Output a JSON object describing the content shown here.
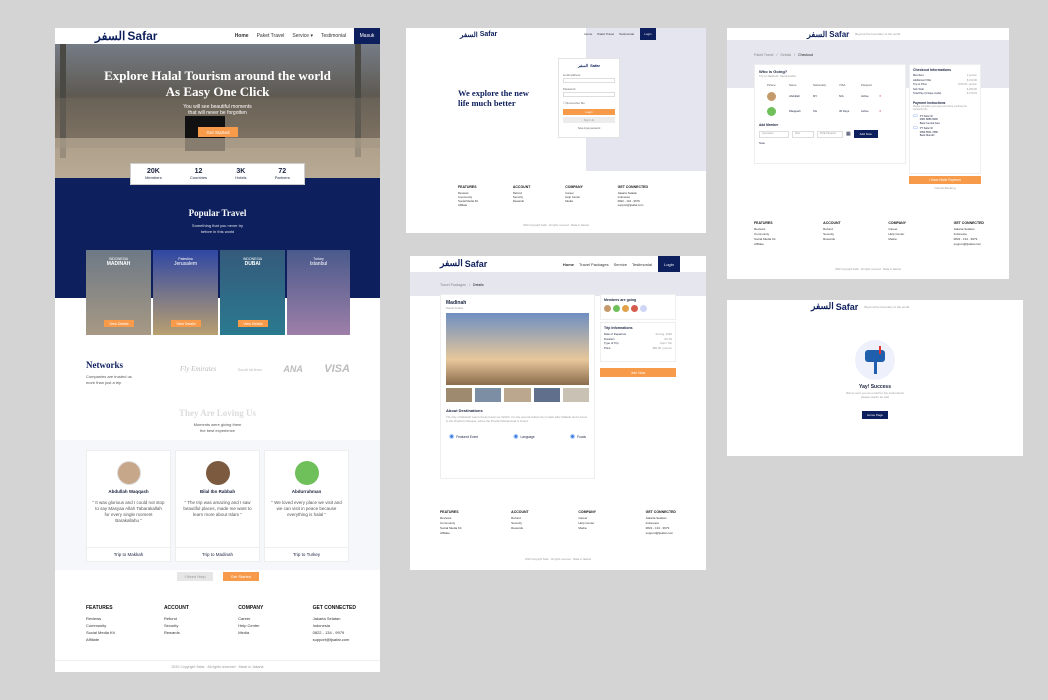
{
  "brand": {
    "arabic": "السفر",
    "latin": "Safar",
    "tagline": "Beyond the boundary of the world"
  },
  "nav": {
    "home": "Home",
    "packages": "Paket Travel",
    "service": "Service",
    "testimonial": "Testimonial",
    "login": "Masuk"
  },
  "nav2": {
    "home": "Home",
    "packages": "Travel Packages",
    "service": "Service",
    "testimonial": "Testimonial",
    "login": "Login"
  },
  "hero": {
    "title": "Explore Halal Tourism around the world\nAs Easy One Click",
    "subtitle": "You will see beautiful moments\nthat will never be forgotten",
    "cta": "Get Started"
  },
  "stats": [
    {
      "value": "20K",
      "label": "Members"
    },
    {
      "value": "12",
      "label": "Countries"
    },
    {
      "value": "3K",
      "label": "Hotels"
    },
    {
      "value": "72",
      "label": "Partners"
    }
  ],
  "popular": {
    "title": "Popular Travel",
    "subtitle": "Something that you never try\nbefore in this world",
    "cards": [
      {
        "country": "INDONESIA",
        "city": "MADINAH",
        "cta": "View Details"
      },
      {
        "country": "Palestina",
        "city": "Jerusalem",
        "cta": "View Details"
      },
      {
        "country": "INDONESIA",
        "city": "DUBAI",
        "cta": "View Details"
      },
      {
        "country": "Turkey",
        "city": "Istanbul",
        "cta": "View Details"
      }
    ]
  },
  "networks": {
    "title": "Networks",
    "subtitle": "Companies are trusted us\nmore than just a trip",
    "logos": [
      "Fly Emirates",
      "Saudi Airlines",
      "ANA",
      "VISA"
    ]
  },
  "testimonials": {
    "title": "They Are Loving Us",
    "subtitle": "Moments were giving them\nthe best experience",
    "items": [
      {
        "name": "Abdullah Waqqash",
        "quote": "\" It was glorious and I could not stop to say Masyaa Allah Tabarakallah for every single moment Barakallahu \"",
        "trip": "Trip to Makkah"
      },
      {
        "name": "Bilal Ibn Rabbah",
        "quote": "\" The trip was amazing and I saw beautiful places, made me want to learn more about Islam \"",
        "trip": "Trip to Madinah"
      },
      {
        "name": "Abdurrahman",
        "quote": "\" We loved every place we visit and we can visit in peace because everything is halal \"",
        "trip": "Trip to Turkey"
      }
    ],
    "help": "I Need Help",
    "cta": "Get Started"
  },
  "footer": {
    "cols": [
      {
        "title": "FEATURES",
        "items": [
          "Reviews",
          "Community",
          "Social Media Kit",
          "Affiliate"
        ]
      },
      {
        "title": "ACCOUNT",
        "items": [
          "Refund",
          "Security",
          "Rewards"
        ]
      },
      {
        "title": "COMPANY",
        "items": [
          "Career",
          "Help Center",
          "Media"
        ]
      },
      {
        "title": "GET CONNECTED",
        "items": [
          "Jakarta Selatan",
          "Indonesia",
          "0822 - 134 - 9979",
          "support@tjsafar.com"
        ]
      }
    ],
    "copyright": "2020 Copyright Safar · All rights reserved · Made in Jakarta"
  },
  "login": {
    "headline": "We explore the new\nlife much better",
    "email": "email address",
    "password": "Password",
    "remember": "Remember Me",
    "login": "Login",
    "signup": "Sign Up",
    "forgot": "Saya lupa password"
  },
  "detail": {
    "crumbs": [
      "Travel Packages",
      "Details"
    ],
    "title": "Madinah",
    "country": "Saudi Arabia",
    "about_title": "About Destinations",
    "about": "The City of Madinah was formerly known as Yathrib. It is the second holiest city in Islam after Makkah and is home to the Prophet's Mosque, where the Prophet Muhammad is buried.",
    "features": [
      "Featured Event",
      "Language",
      "Foods"
    ],
    "members_title": "Members are going",
    "trip_title": "Trip Informations",
    "trip_rows": [
      [
        "Date of Departure",
        "22 Aug, 2020"
      ],
      [
        "Duration",
        "4D 3N"
      ],
      [
        "Type of Trip",
        "Open Trip"
      ],
      [
        "Price",
        "$80,00 / person"
      ]
    ],
    "join": "Join Now"
  },
  "checkout": {
    "crumbs": [
      "Paket Travel",
      "Details",
      "Checkout"
    ],
    "who": "Who is Going?",
    "who_sub": "Trip to Madinah, Saudi Arabia",
    "headers": [
      "Picture",
      "Name",
      "Nationality",
      "VISA",
      "Passport"
    ],
    "rows": [
      [
        "Abdullah",
        "MY",
        "N/A",
        "Active"
      ],
      [
        "Waqqash",
        "SG",
        "30 Days",
        "Active"
      ]
    ],
    "add_member": "Add Member",
    "username": "Username",
    "visa": "Visa",
    "doe": "DOE Passport",
    "add_now": "Add Now",
    "note": "Note",
    "summary_title": "Checkout Informations",
    "summary": [
      [
        "Members",
        "2 person"
      ],
      [
        "Additional VISA",
        "$ 190,00"
      ],
      [
        "Trip to Price",
        "$ 80,00 / person"
      ],
      [
        "Sub Total",
        "$ 280,00"
      ],
      [
        "Total Pay (Unique Code)",
        "$ 279,33"
      ]
    ],
    "payment": "Payment Instructions",
    "payment_sub": "Please complete your payment before continue the wonderful trip",
    "banks": [
      [
        "PT Safar ID",
        "0881 8888 9999",
        "Bank Central Asia"
      ],
      [
        "PT Safar ID",
        "0899 8501 7888",
        "Bank Mandiri"
      ]
    ],
    "pay_btn": "I Have Made Payment",
    "cancel": "Cancel Booking",
    "footer_extra": [
      "Reviews",
      "Community",
      "Social Media Kit",
      "Affiliate"
    ]
  },
  "success": {
    "title": "Yay! Success",
    "text": "We've sent you an email for trip instructions\nplease read it as well",
    "btn": "Home Page"
  }
}
